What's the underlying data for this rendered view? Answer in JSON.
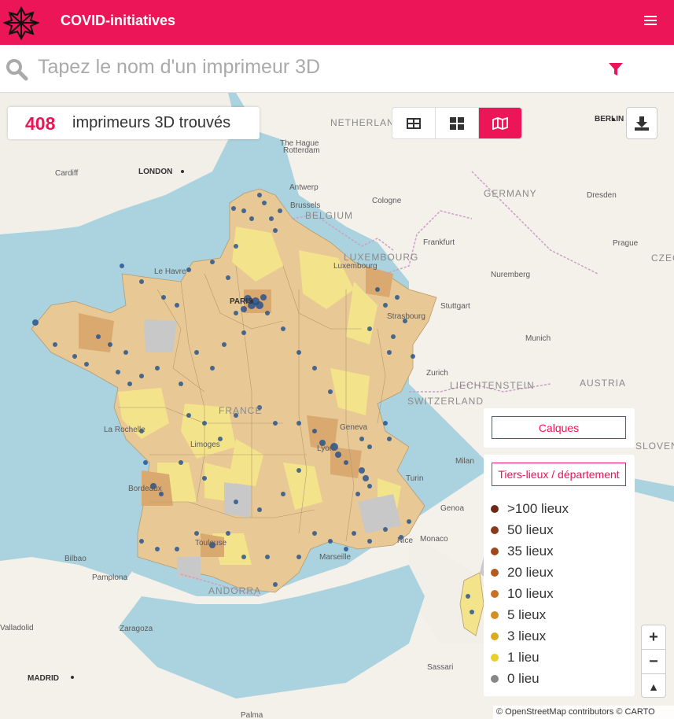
{
  "header": {
    "title": "COVID-initiatives",
    "colors": {
      "brand": "#ec1558"
    }
  },
  "search": {
    "placeholder": "Tapez le nom d'un imprimeur 3D",
    "value": ""
  },
  "results": {
    "count": "408",
    "label": "imprimeurs 3D trouvés"
  },
  "view_modes": [
    {
      "name": "table-icon",
      "active": false
    },
    {
      "name": "grid-icon",
      "active": false
    },
    {
      "name": "map-icon",
      "active": true
    }
  ],
  "map": {
    "countries": [
      "NETHERLANDS",
      "GERMANY",
      "BELGIUM",
      "LUXEMBOURG",
      "LIECHTENSTEIN",
      "AUSTRIA",
      "SWITZERLAND",
      "SLOVENIA",
      "ANDORRA",
      "CZEC"
    ],
    "capitals": [
      "LONDON",
      "BERLIN",
      "PARIS",
      "MADRID"
    ],
    "cities": [
      "The Hague",
      "Rotterdam",
      "Cardiff",
      "Antwerp",
      "Brussels",
      "Cologne",
      "Frankfurt",
      "Dresden",
      "Prague",
      "Le Havre",
      "Luxembourg",
      "Nuremberg",
      "Stuttgart",
      "Strasbourg",
      "Munich",
      "Zurich",
      "FRANCE",
      "Geneva",
      "La Rochelle",
      "Limoges",
      "Lyon",
      "Turin",
      "Milan",
      "Genoa",
      "Bordeaux",
      "Toulouse",
      "Monaco",
      "Nice",
      "Marseille",
      "Bilbao",
      "Pamplona",
      "Valladolid",
      "Zaragoza",
      "Sassari",
      "Palma"
    ],
    "attribution": "© OpenStreetMap contributors © CARTO"
  },
  "layers": {
    "label": "Calques"
  },
  "legend": {
    "title": "Tiers-lieux / département",
    "items": [
      {
        "label": ">100 lieux",
        "color": "#6b2a17"
      },
      {
        "label": "50 lieux",
        "color": "#8a3b1c"
      },
      {
        "label": "35 lieux",
        "color": "#a0481c"
      },
      {
        "label": "20 lieux",
        "color": "#b5591f"
      },
      {
        "label": "10 lieux",
        "color": "#c67222"
      },
      {
        "label": "5 lieux",
        "color": "#d48f23"
      },
      {
        "label": "3 lieux",
        "color": "#ddaa24"
      },
      {
        "label": "1 lieu",
        "color": "#e8cf2a"
      },
      {
        "label": "0 lieu",
        "color": "#888888"
      }
    ]
  },
  "zoom": {
    "in": "+",
    "out": "−",
    "reset": "▲"
  }
}
